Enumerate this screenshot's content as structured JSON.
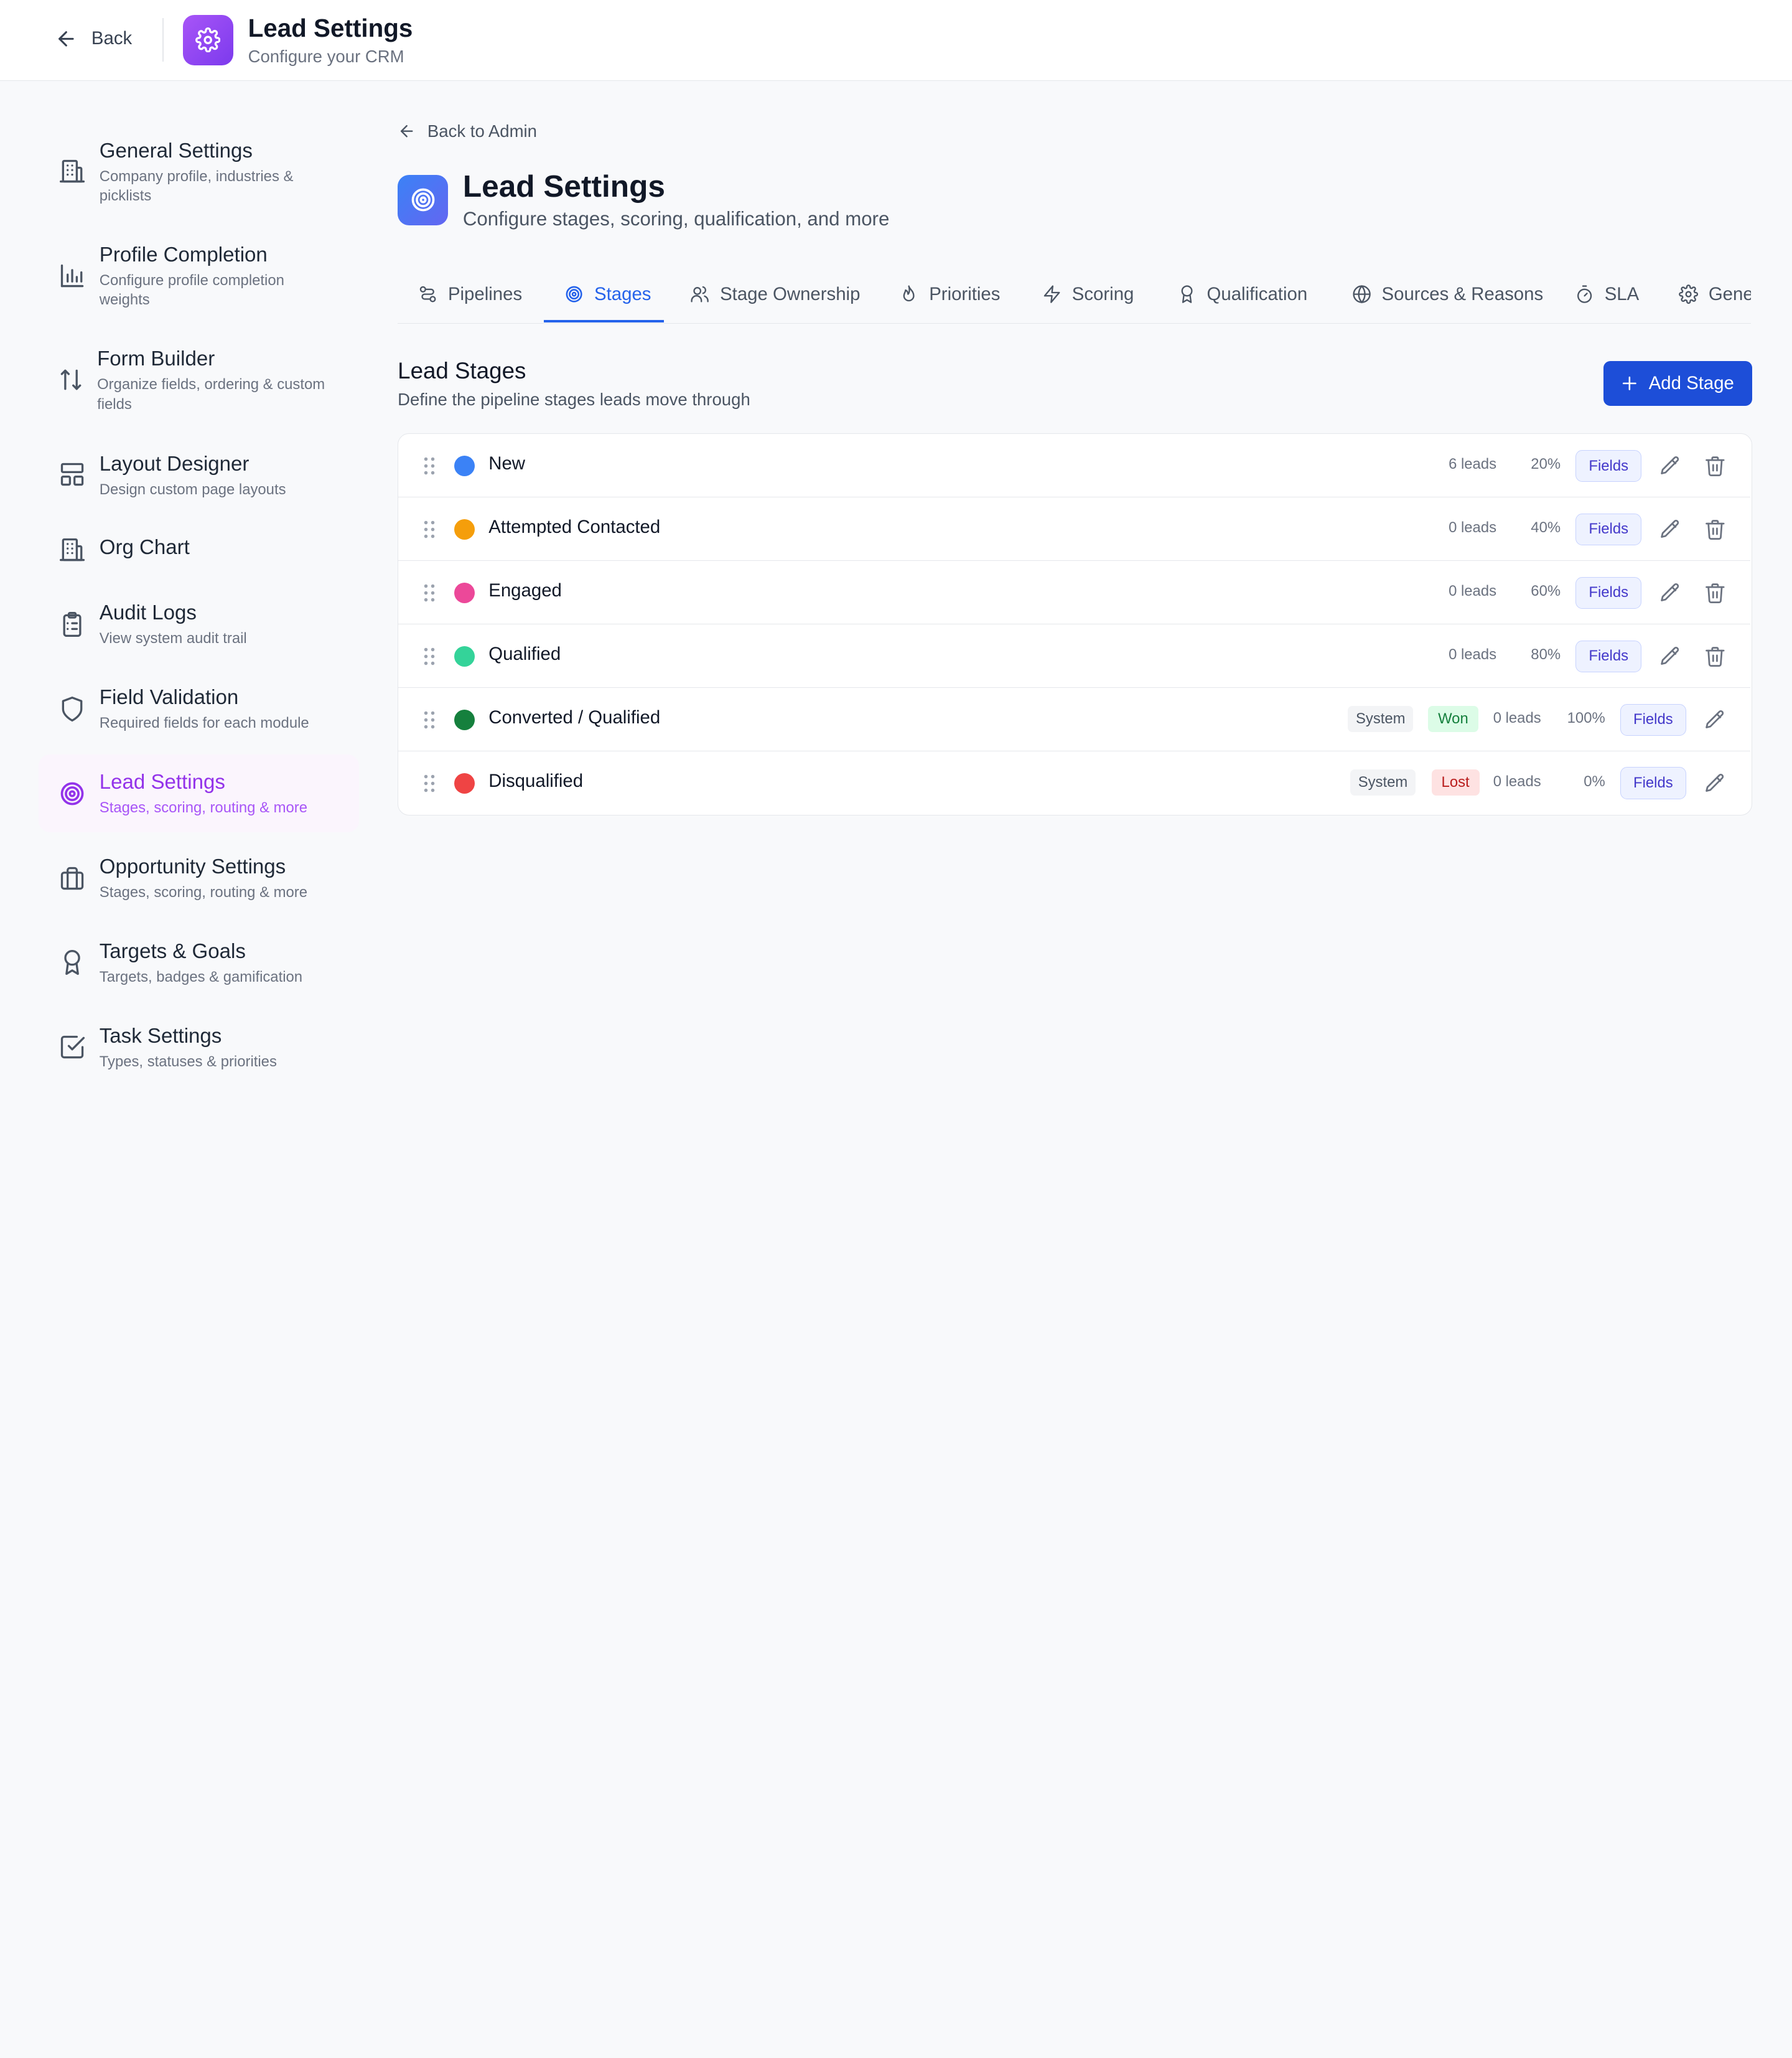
{
  "header": {
    "back_label": "Back",
    "title": "Lead Settings",
    "subtitle": "Configure your CRM"
  },
  "sidebar": {
    "items": [
      {
        "title": "General Settings",
        "desc": "Company profile, industries & picklists",
        "icon": "building-icon"
      },
      {
        "title": "Profile Completion",
        "desc": "Configure profile completion weights",
        "icon": "bar-chart-icon"
      },
      {
        "title": "Form Builder",
        "desc": "Organize fields, ordering & custom fields",
        "icon": "sort-arrows-icon"
      },
      {
        "title": "Layout Designer",
        "desc": "Design custom page layouts",
        "icon": "layout-icon"
      },
      {
        "title": "Org Chart",
        "desc": "",
        "icon": "building-icon"
      },
      {
        "title": "Audit Logs",
        "desc": "View system audit trail",
        "icon": "clipboard-list-icon"
      },
      {
        "title": "Field Validation",
        "desc": "Required fields for each module",
        "icon": "shield-icon"
      },
      {
        "title": "Lead Settings",
        "desc": "Stages, scoring, routing & more",
        "icon": "target-icon",
        "active": true
      },
      {
        "title": "Opportunity Settings",
        "desc": "Stages, scoring, routing & more",
        "icon": "briefcase-icon"
      },
      {
        "title": "Targets & Goals",
        "desc": "Targets, badges & gamification",
        "icon": "award-icon"
      },
      {
        "title": "Task Settings",
        "desc": "Types, statuses & priorities",
        "icon": "check-square-icon"
      }
    ]
  },
  "main": {
    "back_admin_label": "Back to Admin",
    "title": "Lead Settings",
    "subtitle": "Configure stages, scoring, qualification, and more",
    "tabs": [
      {
        "label": "Pipelines",
        "icon": "pipeline-icon"
      },
      {
        "label": "Stages",
        "icon": "target-icon",
        "active": true
      },
      {
        "label": "Stage Ownership",
        "icon": "users-icon"
      },
      {
        "label": "Priorities",
        "icon": "flame-icon"
      },
      {
        "label": "Scoring",
        "icon": "zap-icon"
      },
      {
        "label": "Qualification",
        "icon": "award-icon"
      },
      {
        "label": "Sources & Reasons",
        "icon": "globe-icon"
      },
      {
        "label": "SLA",
        "icon": "timer-icon"
      },
      {
        "label": "Gene",
        "icon": "gear-icon"
      }
    ],
    "section_title": "Lead Stages",
    "section_subtitle": "Define the pipeline stages leads move through",
    "add_button_label": "Add Stage"
  },
  "stages": [
    {
      "name": "New",
      "color": "#3b82f6",
      "leads": "6 leads",
      "pct": "20%",
      "fields_label": "Fields",
      "system": false
    },
    {
      "name": "Attempted Contacted",
      "color": "#f59e0b",
      "leads": "0 leads",
      "pct": "40%",
      "fields_label": "Fields",
      "system": false
    },
    {
      "name": "Engaged",
      "color": "#ec4899",
      "leads": "0 leads",
      "pct": "60%",
      "fields_label": "Fields",
      "system": false
    },
    {
      "name": "Qualified",
      "color": "#34d399",
      "leads": "0 leads",
      "pct": "80%",
      "fields_label": "Fields",
      "system": false
    },
    {
      "name": "Converted / Qualified",
      "color": "#15803d",
      "leads": "0 leads",
      "pct": "100%",
      "fields_label": "Fields",
      "system": true,
      "system_label": "System",
      "outcome": "Won"
    },
    {
      "name": "Disqualified",
      "color": "#ef4444",
      "leads": "0 leads",
      "pct": "0%",
      "fields_label": "Fields",
      "system": true,
      "system_label": "System",
      "outcome": "Lost"
    }
  ]
}
